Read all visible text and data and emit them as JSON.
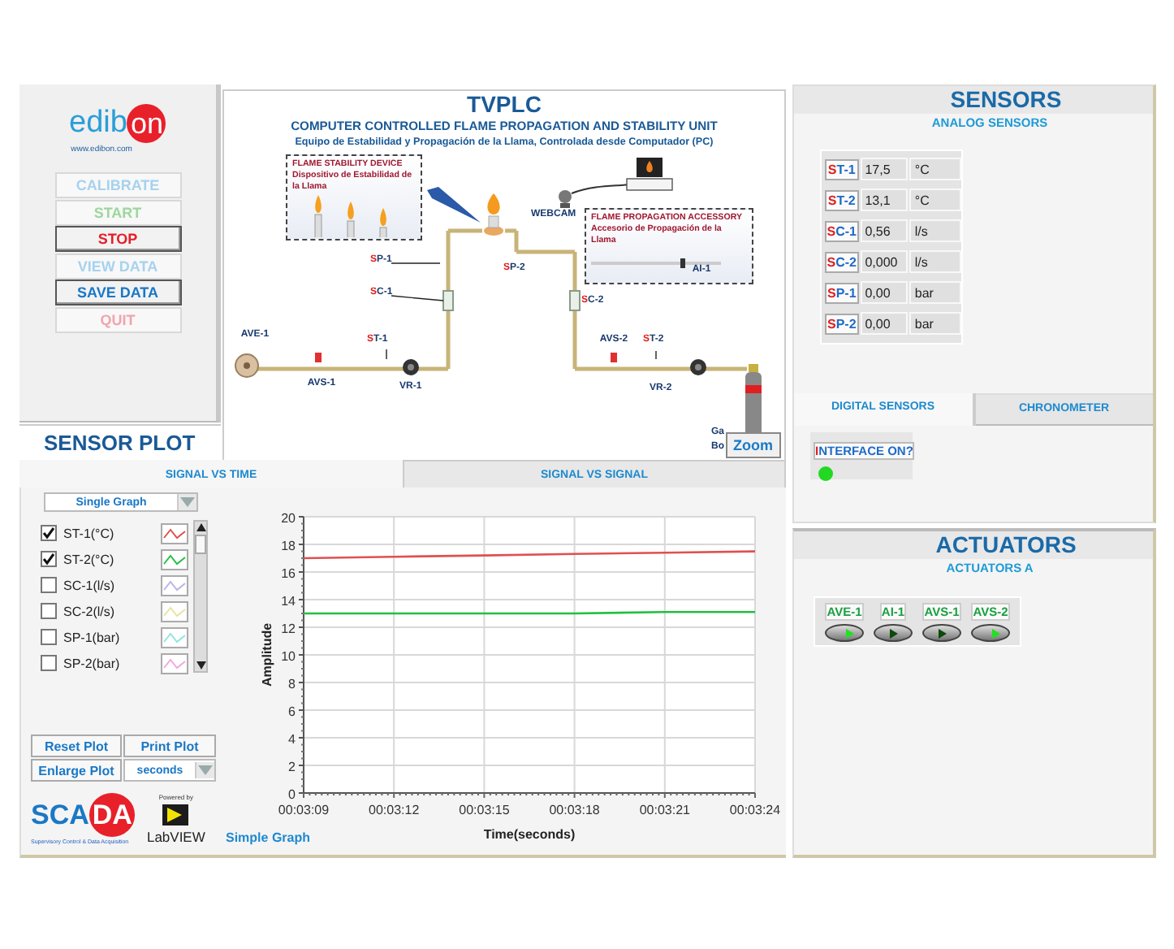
{
  "header": {
    "logo": {
      "left": "edib",
      "right": "on"
    },
    "url": "www.edibon.com"
  },
  "control_buttons": [
    {
      "label": "CALIBRATE",
      "color": "#a6d2ee",
      "disabled": true
    },
    {
      "label": "START",
      "color": "#9fd69f",
      "disabled": true
    },
    {
      "label": "STOP",
      "color": "#e4202a",
      "disabled": false
    },
    {
      "label": "VIEW DATA",
      "color": "#a6d2ee",
      "disabled": true
    },
    {
      "label": "SAVE DATA",
      "color": "#1a78c6",
      "disabled": false
    },
    {
      "label": "QUIT",
      "color": "#f2a4ac",
      "disabled": true
    }
  ],
  "diagram": {
    "title": "TVPLC",
    "subtitle": "COMPUTER CONTROLLED FLAME PROPAGATION AND STABILITY UNIT",
    "subtitle_es": "Equipo de Estabilidad y Propagación de la Llama, Controlada desde Computador (PC)",
    "callouts": [
      {
        "title": "FLAME STABILITY DEVICE",
        "text": "Dispositivo de Estabilidad de la Llama"
      },
      {
        "title": "FLAME PROPAGATION ACCESSORY",
        "text": "Accesorio de Propagación de la Llama"
      }
    ],
    "labels": [
      {
        "text": "AVE-1",
        "kind": "actuator"
      },
      {
        "text": "AVS-1",
        "kind": "actuator"
      },
      {
        "text": "ST-1",
        "kind": "sensor"
      },
      {
        "text": "VR-1",
        "kind": "plain"
      },
      {
        "text": "SP-1",
        "kind": "sensor"
      },
      {
        "text": "SC-1",
        "kind": "sensor"
      },
      {
        "text": "SP-2",
        "kind": "sensor"
      },
      {
        "text": "SC-2",
        "kind": "sensor"
      },
      {
        "text": "AVS-2",
        "kind": "actuator"
      },
      {
        "text": "ST-2",
        "kind": "sensor"
      },
      {
        "text": "VR-2",
        "kind": "plain"
      },
      {
        "text": "AI-1",
        "kind": "actuator"
      },
      {
        "text": "WEBCAM",
        "kind": "plain"
      },
      {
        "text": "Ga",
        "kind": "plain"
      },
      {
        "text": "Bo",
        "kind": "plain"
      }
    ],
    "zoom_button": "Zoom"
  },
  "sensor_plot": {
    "title": "SENSOR PLOT",
    "tabs": [
      {
        "label": "SIGNAL VS TIME",
        "selected": true
      },
      {
        "label": "SIGNAL VS SIGNAL",
        "selected": false
      }
    ],
    "graph_mode": "Single Graph",
    "signals": [
      {
        "label": "ST-1(°C)",
        "checked": true,
        "color": "#e05050"
      },
      {
        "label": "ST-2(°C)",
        "checked": true,
        "color": "#20c040"
      },
      {
        "label": "SC-1(l/s)",
        "checked": false,
        "color": "#b8b4e8"
      },
      {
        "label": "SC-2(l/s)",
        "checked": false,
        "color": "#e8e4a0"
      },
      {
        "label": "SP-1(bar)",
        "checked": false,
        "color": "#90e4e0"
      },
      {
        "label": "SP-2(bar)",
        "checked": false,
        "color": "#f0a8dc"
      }
    ],
    "buttons": [
      "Reset Plot",
      "Print Plot",
      "Enlarge Plot"
    ],
    "time_unit": "seconds",
    "graph_caption": "Simple Graph",
    "chart_data": {
      "type": "line",
      "grid": true,
      "xlabel": "Time(seconds)",
      "ylabel": "Amplitude",
      "categories": [
        "00:03:09",
        "00:03:12",
        "00:03:15",
        "00:03:18",
        "00:03:21",
        "00:03:24"
      ],
      "ylim": [
        0,
        20
      ],
      "yticks": [
        0,
        2,
        4,
        6,
        8,
        10,
        12,
        14,
        16,
        18,
        20
      ],
      "series": [
        {
          "color": "#e05050",
          "values": [
            17.0,
            17.1,
            17.2,
            17.3,
            17.4,
            17.5
          ]
        },
        {
          "color": "#20c040",
          "values": [
            13.0,
            13.0,
            13.0,
            13.0,
            13.1,
            13.1
          ]
        }
      ]
    }
  },
  "sensors": {
    "title": "SENSORS",
    "subtitle": "ANALOG SENSORS",
    "readings": [
      {
        "tag": "ST-1",
        "value": "17,5",
        "unit": "°C"
      },
      {
        "tag": "ST-2",
        "value": "13,1",
        "unit": "°C"
      },
      {
        "tag": "SC-1",
        "value": "0,56",
        "unit": "l/s"
      },
      {
        "tag": "SC-2",
        "value": "0,000",
        "unit": "l/s"
      },
      {
        "tag": "SP-1",
        "value": "0,00",
        "unit": "bar"
      },
      {
        "tag": "SP-2",
        "value": "0,00",
        "unit": "bar"
      }
    ],
    "tabs": [
      {
        "label": "DIGITAL SENSORS",
        "selected": true
      },
      {
        "label": "CHRONOMETER",
        "selected": false
      }
    ],
    "interface": {
      "label": "INTERFACE ON?",
      "on": true
    }
  },
  "actuators": {
    "title": "ACTUATORS",
    "subtitle": "ACTUATORS A",
    "items": [
      {
        "label": "AVE-1",
        "on": true
      },
      {
        "label": "AI-1",
        "on": false
      },
      {
        "label": "AVS-1",
        "on": false
      },
      {
        "label": "AVS-2",
        "on": true
      }
    ]
  },
  "footer": {
    "scada": {
      "left": "SCA",
      "right": "DA",
      "tagline": "Supervisory Control & Data Acquisition"
    },
    "powered_by": "Powered by",
    "labview": "LabVIEW"
  }
}
